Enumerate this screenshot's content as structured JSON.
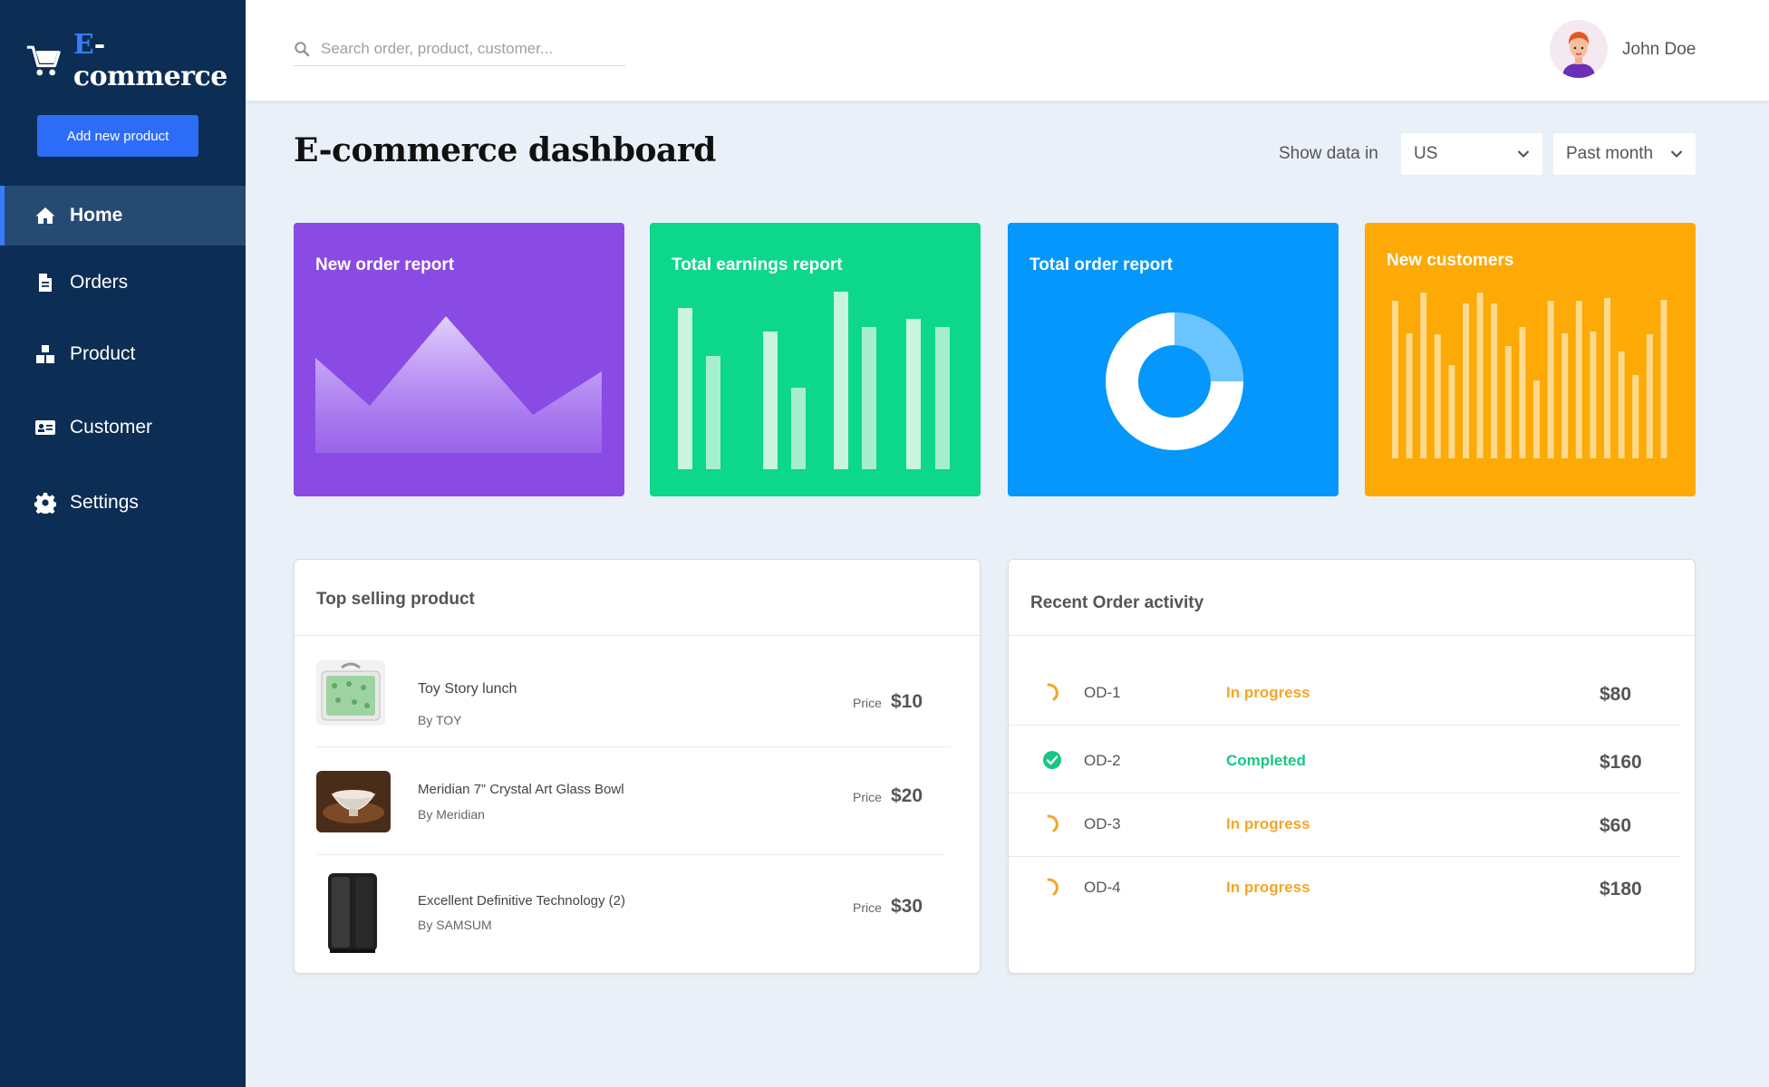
{
  "brand": {
    "name_prefix": "E",
    "name_rest": "-commerce"
  },
  "sidebar": {
    "add_button": "Add new product",
    "items": [
      {
        "label": "Home",
        "icon": "home-icon",
        "active": true
      },
      {
        "label": "Orders",
        "icon": "document-icon",
        "active": false
      },
      {
        "label": "Product",
        "icon": "boxes-icon",
        "active": false
      },
      {
        "label": "Customer",
        "icon": "id-card-icon",
        "active": false
      },
      {
        "label": "Settings",
        "icon": "gear-icon",
        "active": false
      }
    ]
  },
  "header": {
    "search_placeholder": "Search order, product, customer...",
    "user_name": "John Doe"
  },
  "main": {
    "title": "E-commerce dashboard",
    "show_data_label": "Show data in",
    "region_select": "US",
    "period_select": "Past month"
  },
  "cards": [
    {
      "title": "New order report",
      "color": "#8a4be4"
    },
    {
      "title": "Total earnings report",
      "color": "#0dd78b"
    },
    {
      "title": "Total order report",
      "color": "#0597fb"
    },
    {
      "title": "New customers",
      "color": "#fda906"
    }
  ],
  "top_selling": {
    "title": "Top selling product",
    "price_label": "Price",
    "products": [
      {
        "name": "Toy Story lunch",
        "brand": "By TOY",
        "price": "$10"
      },
      {
        "name": "Meridian 7” Crystal Art Glass Bowl",
        "brand": "By Meridian",
        "price": "$20"
      },
      {
        "name": "Excellent Definitive Technology (2)",
        "brand": "By SAMSUM",
        "price": "$30"
      }
    ]
  },
  "recent_orders": {
    "title": "Recent Order activity",
    "orders": [
      {
        "id": "OD-1",
        "status": "In progress",
        "amount": "$80",
        "status_color": "#f5a623"
      },
      {
        "id": "OD-2",
        "status": "Completed",
        "amount": "$160",
        "status_color": "#16c784"
      },
      {
        "id": "OD-3",
        "status": "In progress",
        "amount": "$60",
        "status_color": "#f5a623"
      },
      {
        "id": "OD-4",
        "status": "In progress",
        "amount": "$180",
        "status_color": "#f5a623"
      }
    ]
  }
}
